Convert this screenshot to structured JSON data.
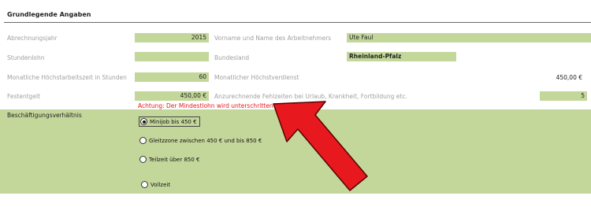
{
  "section": {
    "title": "Grundlegende Angaben"
  },
  "fields": {
    "abrechnungsjahr": {
      "label": "Abrechnungsjahr",
      "value": "2015"
    },
    "name": {
      "label": "Vorname und Name des Arbeitnehmers",
      "value": "Ute Faul"
    },
    "stundenlohn": {
      "label": "Stundenlohn",
      "value": ""
    },
    "bundesland": {
      "label": "Bundesland",
      "value": "Rheinland-Pfalz"
    },
    "hoechstarbeitszeit": {
      "label": "Monatliche Höchstarbeitszeit in Stunden",
      "value": "60"
    },
    "hoechstverdienst": {
      "label": "Monatlicher Höchstverdienst",
      "value": "450,00 €"
    },
    "festentgelt": {
      "label": "Festentgelt",
      "value": "450,00 €"
    },
    "fehlzeiten": {
      "label": "Anzurechnende Fehlzeiten bei Urlaub, Krankheit, Fortbildung etc.",
      "value": "5"
    }
  },
  "warning": "Achtung: Der Mindestlohn wird unterschritten!",
  "employment": {
    "title": "Beschäftigungsverhältnis",
    "options": [
      {
        "label": "Minijob bis 450 €",
        "selected": true
      },
      {
        "label": "Gleitzzone zwischen 450 € und bis 850 €",
        "selected": false
      },
      {
        "label": "Teilzeit über 850 €",
        "selected": false
      },
      {
        "label": "Vollzeit",
        "selected": false
      }
    ]
  },
  "annotation": {
    "arrow_color": "#e8191e",
    "arrow_outline": "#5a0000"
  }
}
